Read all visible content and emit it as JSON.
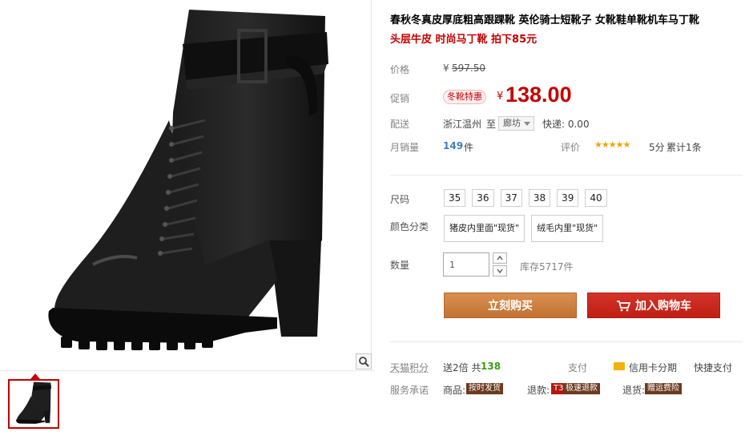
{
  "product": {
    "title": "春秋冬真皮厚底粗高跟踝靴 英伦骑士短靴子 女靴鞋单靴机车马丁靴",
    "subtitle": "头层牛皮 时尚马丁靴 拍下85元"
  },
  "price": {
    "label": "价格",
    "currency": "¥",
    "original": "597.50"
  },
  "promo": {
    "label": "促销",
    "badge": "冬靴特惠",
    "currency": "¥",
    "price": "138.00"
  },
  "shipping": {
    "label": "配送",
    "origin": "浙江温州",
    "to": "至",
    "destination": "廊坊",
    "express": "快递: 0.00"
  },
  "sales": {
    "label": "月销量",
    "count": "149",
    "unit": "件",
    "rating_label": "评价",
    "stars": "★★★★★",
    "rating_value": 5,
    "score": "5分",
    "total": "累计1条"
  },
  "size": {
    "label": "尺码",
    "options": [
      "35",
      "36",
      "37",
      "38",
      "39",
      "40"
    ]
  },
  "color": {
    "label": "颜色分类",
    "options": [
      "猪皮内里面\"现货\"",
      "绒毛内里\"现货\""
    ]
  },
  "quantity": {
    "label": "数量",
    "value": "1",
    "stock": "库存5717件"
  },
  "actions": {
    "buy_now": "立刻购买",
    "add_to_cart": "加入购物车"
  },
  "points": {
    "label": "天猫积分",
    "text_prefix": "送2倍 共",
    "amount": "138",
    "pay_label": "支付",
    "credit": "信用卡分期",
    "fast_pay": "快捷支付"
  },
  "service": {
    "label": "服务承诺",
    "goods_label": "商品:",
    "goods_tag": "按时发货",
    "refund_label": "退款:",
    "refund_badge": "T3",
    "refund_tag": "极速退款",
    "return_label": "退货:",
    "return_tag": "赠运费险"
  },
  "colors": {
    "brand_red": "#c40000",
    "buy_orange": "#cb7a3b",
    "cart_red": "#c8261b",
    "star_yellow": "#f4a300"
  },
  "icons": [
    "zoom-icon",
    "cart-icon",
    "credit-card-icon",
    "chevron-up-icon",
    "chevron-down-icon",
    "dropdown-arrow-icon"
  ]
}
